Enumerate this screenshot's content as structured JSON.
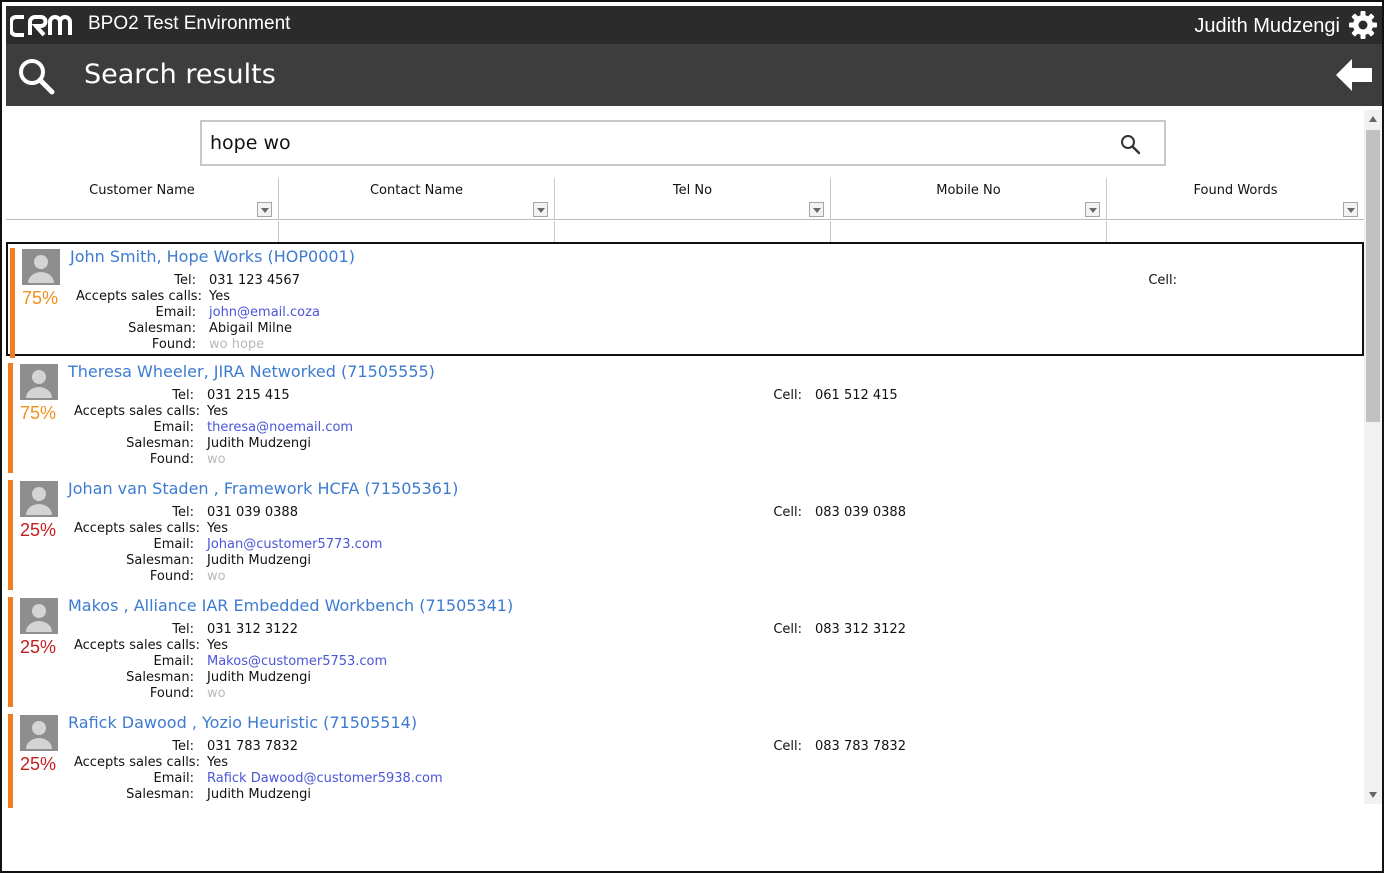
{
  "header": {
    "app_title": "BPO2 Test Environment",
    "user_name": "Judith Mudzengi",
    "logo_icon": "crm-logo",
    "settings_icon": "gear-icon"
  },
  "subheader": {
    "title": "Search results",
    "search_icon": "search-icon",
    "back_icon": "back-arrow-icon"
  },
  "search": {
    "value": "hope wo",
    "button_icon": "search-icon"
  },
  "columns": [
    "Customer Name",
    "Contact Name",
    "Tel No",
    "Mobile No",
    "Found Words"
  ],
  "field_labels": {
    "tel": "Tel:",
    "accepts": "Accepts sales calls:",
    "email": "Email:",
    "salesman": "Salesman:",
    "found": "Found:",
    "cell": "Cell:"
  },
  "colors": {
    "accent": "#f07d1e",
    "pct_high": "#f0901e",
    "pct_low": "#c41e1e",
    "link": "#3d7bd1",
    "email": "#4a55d8"
  },
  "results": [
    {
      "name": "John Smith, Hope Works (HOP0001)",
      "match": "75%",
      "tel": "031 123 4567",
      "accepts": "Yes",
      "email": "john@email.coza",
      "salesman": "Abigail Milne",
      "found": "wo hope",
      "cell": "",
      "selected": true
    },
    {
      "name": "Theresa Wheeler, JIRA Networked (71505555)",
      "match": "75%",
      "tel": "031 215 415",
      "accepts": "Yes",
      "email": "theresa@noemail.com",
      "salesman": "Judith Mudzengi",
      "found": "wo",
      "cell": "061 512 415",
      "selected": false
    },
    {
      "name": "Johan van Staden , Framework HCFA (71505361)",
      "match": "25%",
      "tel": "031 039 0388",
      "accepts": "Yes",
      "email": "Johan@customer5773.com",
      "salesman": "Judith Mudzengi",
      "found": "wo",
      "cell": "083 039 0388",
      "selected": false
    },
    {
      "name": "Makos , Alliance IAR Embedded Workbench (71505341)",
      "match": "25%",
      "tel": "031 312 3122",
      "accepts": "Yes",
      "email": "Makos@customer5753.com",
      "salesman": "Judith Mudzengi",
      "found": "wo",
      "cell": "083 312 3122",
      "selected": false
    },
    {
      "name": "Rafick Dawood , Yozio Heuristic (71505514)",
      "match": "25%",
      "tel": "031 783 7832",
      "accepts": "Yes",
      "email": "Rafick Dawood@customer5938.com",
      "salesman": "Judith Mudzengi",
      "found": "",
      "cell": "083 783 7832",
      "selected": false
    }
  ]
}
